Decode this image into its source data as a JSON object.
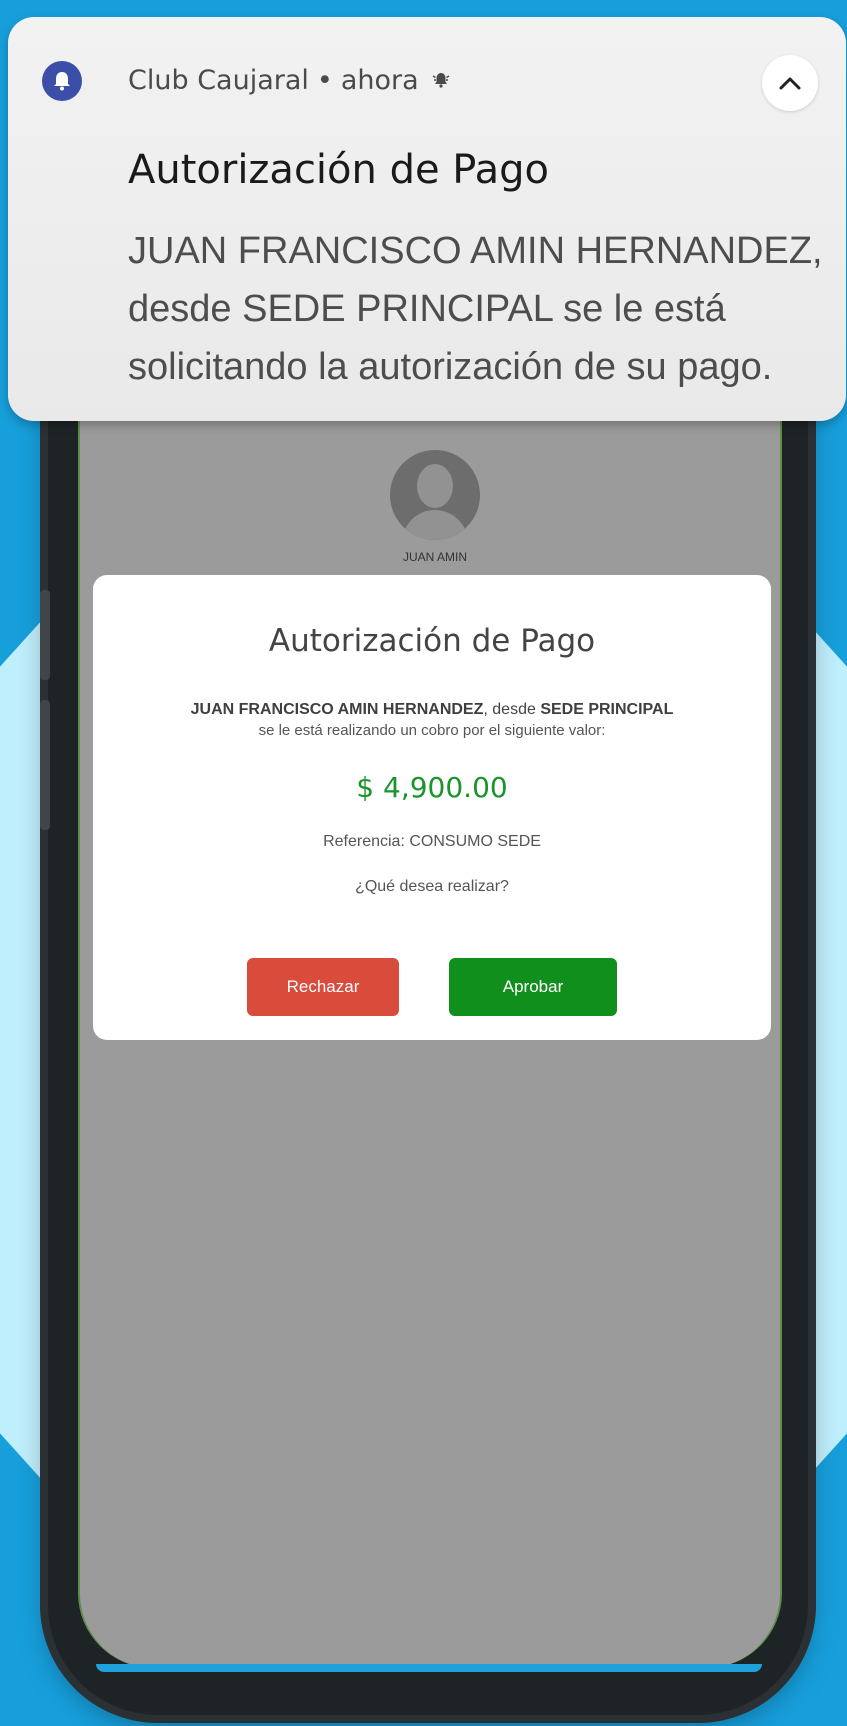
{
  "notification": {
    "app_name": "Club Caujaral",
    "separator": "•",
    "time": "ahora",
    "title": "Autorización de Pago",
    "body": "JUAN FRANCISCO AMIN HERNANDEZ, desde SEDE PRINCIPAL se le está solicitando la autorización de su pago.",
    "app_icon": "bell-icon",
    "status_icon": "bell-ring-icon",
    "expand_icon": "chevron-up-icon"
  },
  "profile": {
    "name": "JUAN AMIN",
    "avatar_icon": "user-silhouette-icon"
  },
  "modal": {
    "title": "Autorización de Pago",
    "customer_name": "JUAN FRANCISCO AMIN HERNANDEZ",
    "from_word": ", desde ",
    "location": "SEDE PRINCIPAL",
    "line2": "se le está realizando un cobro por el siguiente valor:",
    "amount": "$ 4,900.00",
    "reference": "Referencia: CONSUMO SEDE",
    "question": "¿Qué desea realizar?",
    "reject_label": "Rechazar",
    "approve_label": "Aprobar"
  },
  "colors": {
    "background": "#179fdc",
    "amount": "#19952c",
    "reject": "#d94b3b",
    "approve": "#118f1c",
    "app_icon": "#3b4ea8"
  }
}
